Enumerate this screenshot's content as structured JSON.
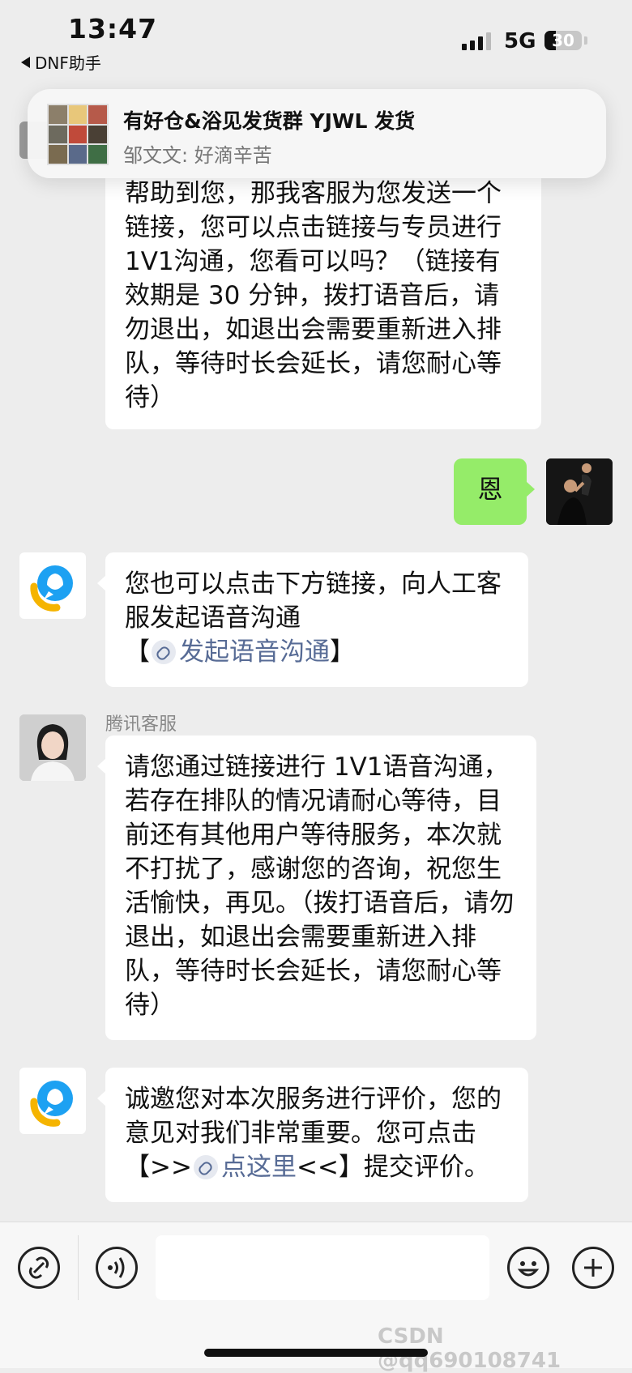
{
  "status_bar": {
    "time": "13:47",
    "back_app": "DNF助手",
    "network": "5G",
    "battery": "30",
    "battery_level": 0.3,
    "signal_bars": 3
  },
  "notification": {
    "title": "有好仓&浴见发货群 YJWL 发货",
    "preview": "邹文文: 好滴辛苦"
  },
  "messages": [
    {
      "side": "left",
      "text": "帮助到您，那我客服为您发送一个链接，您可以点击链接与专员进行 1V1沟通，您看可以吗？（链接有效期是 30 分钟，拨打语音后，请勿退出，如退出会需要重新进入排队，等待时长会延长，请您耐心等待）"
    },
    {
      "side": "right",
      "text": "恩"
    },
    {
      "side": "left",
      "text": "您也可以点击下方链接，向人工客服发起语音沟通",
      "bracket_open": "【",
      "link_text": "发起语音沟通",
      "bracket_close": "】"
    },
    {
      "side": "left",
      "sender": "腾讯客服",
      "text": "请您通过链接进行 1V1语音沟通，若存在排队的情况请耐心等待，目前还有其他用户等待服务，本次就不打扰了，感谢您的咨询，祝您生活愉快，再见。（拨打语音后，请勿退出，如退出会需要重新进入排队，等待时长会延长，请您耐心等待）"
    },
    {
      "side": "left",
      "text_before": "诚邀您对本次服务进行评价，您的意见对我们非常重要。您可点击【>>",
      "link_text": "点这里",
      "text_after": "<<】提交评价。"
    }
  ],
  "watermark": "CSDN @qq690108741",
  "colors": {
    "background": "#ededed",
    "bubble_green": "#95ec69",
    "link": "#576b95"
  },
  "icons": {
    "bottom_left": "link-icon",
    "voice": "voice-icon",
    "emoji": "emoji-icon",
    "add": "add-icon"
  }
}
